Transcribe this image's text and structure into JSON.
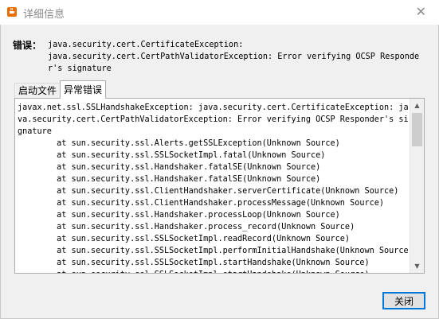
{
  "window": {
    "title": "详细信息",
    "app_icon": "java-cup-icon",
    "close_symbol": "✕"
  },
  "error": {
    "label": "错误：",
    "message": "java.security.cert.CertificateException:\njava.security.cert.CertPathValidatorException: Error verifying OCSP Responder's signature"
  },
  "tabs": [
    {
      "label": "启动文件",
      "active": false
    },
    {
      "label": "异常错误",
      "active": true
    }
  ],
  "trace": {
    "header": "javax.net.ssl.SSLHandshakeException: java.security.cert.CertificateException: java.security.cert.CertPathValidatorException: Error verifying OCSP Responder's signature",
    "lines": [
      "\tat sun.security.ssl.Alerts.getSSLException(Unknown Source)",
      "\tat sun.security.ssl.SSLSocketImpl.fatal(Unknown Source)",
      "\tat sun.security.ssl.Handshaker.fatalSE(Unknown Source)",
      "\tat sun.security.ssl.Handshaker.fatalSE(Unknown Source)",
      "\tat sun.security.ssl.ClientHandshaker.serverCertificate(Unknown Source)",
      "\tat sun.security.ssl.ClientHandshaker.processMessage(Unknown Source)",
      "\tat sun.security.ssl.Handshaker.processLoop(Unknown Source)",
      "\tat sun.security.ssl.Handshaker.process_record(Unknown Source)",
      "\tat sun.security.ssl.SSLSocketImpl.readRecord(Unknown Source)",
      "\tat sun.security.ssl.SSLSocketImpl.performInitialHandshake(Unknown Source)",
      "\tat sun.security.ssl.SSLSocketImpl.startHandshake(Unknown Source)",
      "\tat sun.security.ssl.SSLSocketImpl.startHandshake(Unknown Source)"
    ]
  },
  "buttons": {
    "close_label": "关闭"
  },
  "colors": {
    "focus_border": "#0078d7",
    "window_bg": "#f0f0f0"
  }
}
